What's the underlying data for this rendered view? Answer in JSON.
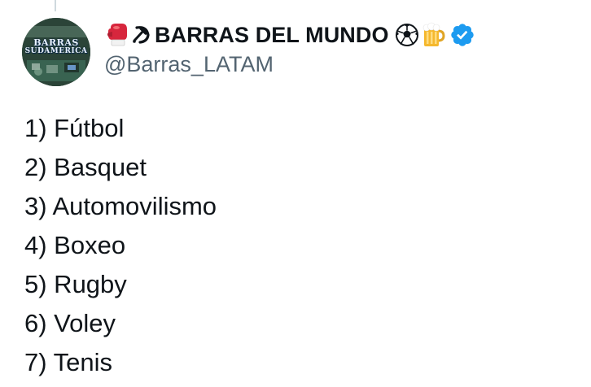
{
  "author": {
    "display_name": "BARRAS DEL MUNDO",
    "handle": "@Barras_LATAM",
    "verified": true,
    "avatar_text_top": "BARRAS",
    "avatar_text_bottom": "SUDAMERICA",
    "name_prefix_icons": [
      "boxing-glove-icon",
      "hammer-sickle-icon"
    ],
    "name_suffix_icons": [
      "soccer-ball-icon",
      "beer-mug-icon",
      "verified-badge-icon"
    ]
  },
  "tweet": {
    "lines": [
      "1) Fútbol",
      "2) Basquet",
      "3) Automovilismo",
      "4) Boxeo",
      "5) Rugby",
      "6) Voley",
      "7) Tenis"
    ]
  },
  "colors": {
    "text": "#0f1419",
    "secondary_text": "#536471",
    "verified_blue": "#1d9bf0",
    "thread_line": "#cfd9de"
  }
}
